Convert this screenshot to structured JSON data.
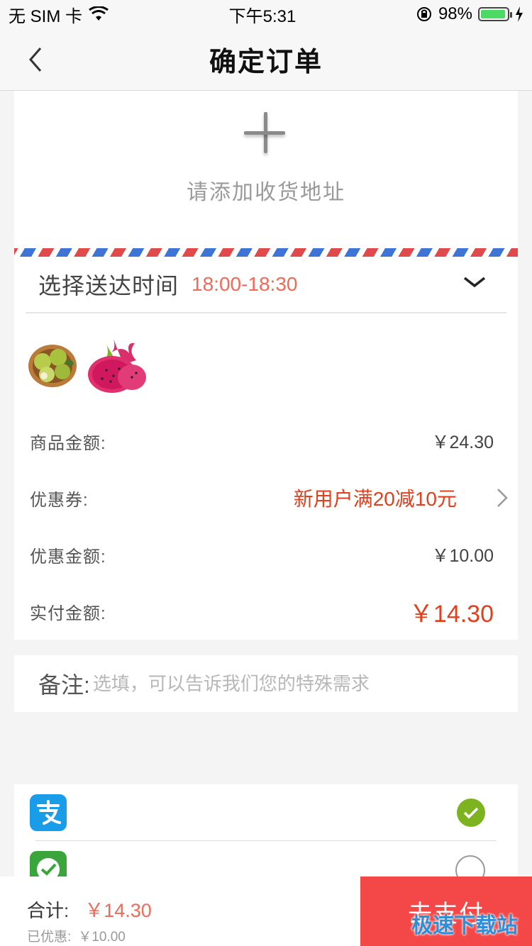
{
  "status_bar": {
    "carrier": "无 SIM 卡",
    "time": "下午5:31",
    "battery": "98%",
    "battery_level": 0.98
  },
  "nav": {
    "title": "确定订单"
  },
  "address": {
    "add_label": "请添加收货地址"
  },
  "delivery": {
    "label": "选择送达时间",
    "time": "18:00-18:30"
  },
  "products": [
    {
      "name": "pear-basket-image"
    },
    {
      "name": "dragon-fruit-image"
    }
  ],
  "fees": {
    "goods_label": "商品金额:",
    "goods_value": "￥24.30",
    "coupon_label": "优惠券:",
    "coupon_value": "新用户满20减10元",
    "discount_label": "优惠金额:",
    "discount_value": "￥10.00",
    "actual_label": "实付金额:",
    "actual_value": "￥14.30"
  },
  "note": {
    "label": "备注:",
    "placeholder": "选填，可以告诉我们您的特殊需求"
  },
  "payment": {
    "options": [
      {
        "icon": "alipay-icon",
        "selected": true
      },
      {
        "icon": "wechat-pay-icon",
        "selected": false
      }
    ]
  },
  "bottom": {
    "total_label": "合计:",
    "total_value": "￥14.30",
    "saved_label": "已优惠:",
    "saved_value": "￥10.00",
    "pay_button": "去支付"
  },
  "watermark": "极速下载站",
  "colors": {
    "accent_red": "#e2401c",
    "pay_button": "#f44848",
    "time_highlight": "#f06a5a",
    "selected_green": "#7db31f"
  }
}
